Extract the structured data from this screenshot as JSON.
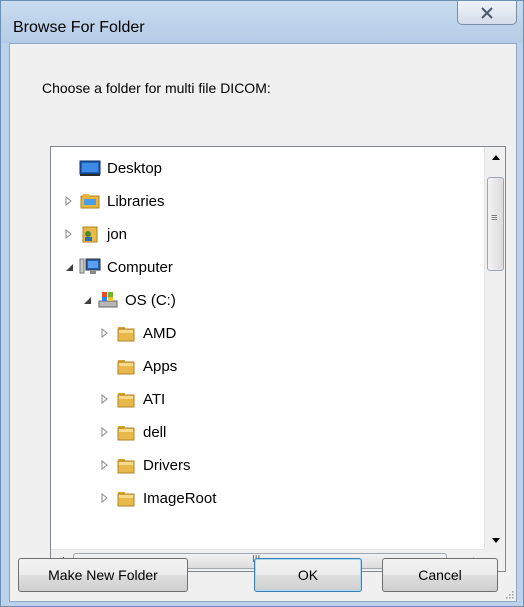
{
  "window": {
    "title": "Browse For Folder"
  },
  "dialog": {
    "prompt": "Choose a folder for multi file DICOM:"
  },
  "tree": {
    "items": [
      {
        "label": "Desktop",
        "icon": "desktop-icon",
        "expander": "none"
      },
      {
        "label": "Libraries",
        "icon": "libraries-icon",
        "expander": "collapsed"
      },
      {
        "label": "jon",
        "icon": "user-folder-icon",
        "expander": "collapsed"
      },
      {
        "label": "Computer",
        "icon": "computer-icon",
        "expander": "expanded"
      },
      {
        "label": "OS (C:)",
        "icon": "drive-icon",
        "expander": "expanded"
      },
      {
        "label": "AMD",
        "icon": "folder-icon",
        "expander": "collapsed"
      },
      {
        "label": "Apps",
        "icon": "folder-icon",
        "expander": "none"
      },
      {
        "label": "ATI",
        "icon": "folder-icon",
        "expander": "collapsed"
      },
      {
        "label": "dell",
        "icon": "folder-icon",
        "expander": "collapsed"
      },
      {
        "label": "Drivers",
        "icon": "folder-icon",
        "expander": "collapsed"
      },
      {
        "label": "ImageRoot",
        "icon": "folder-icon",
        "expander": "collapsed"
      }
    ],
    "scroll_grip": "≡",
    "hscroll_grip": "III"
  },
  "buttons": {
    "make_new_folder": "Make New Folder",
    "ok": "OK",
    "cancel": "Cancel"
  },
  "colors": {
    "frame": "#bcd2ea",
    "client": "#f0f0f0",
    "folder": "#e8b94a"
  }
}
